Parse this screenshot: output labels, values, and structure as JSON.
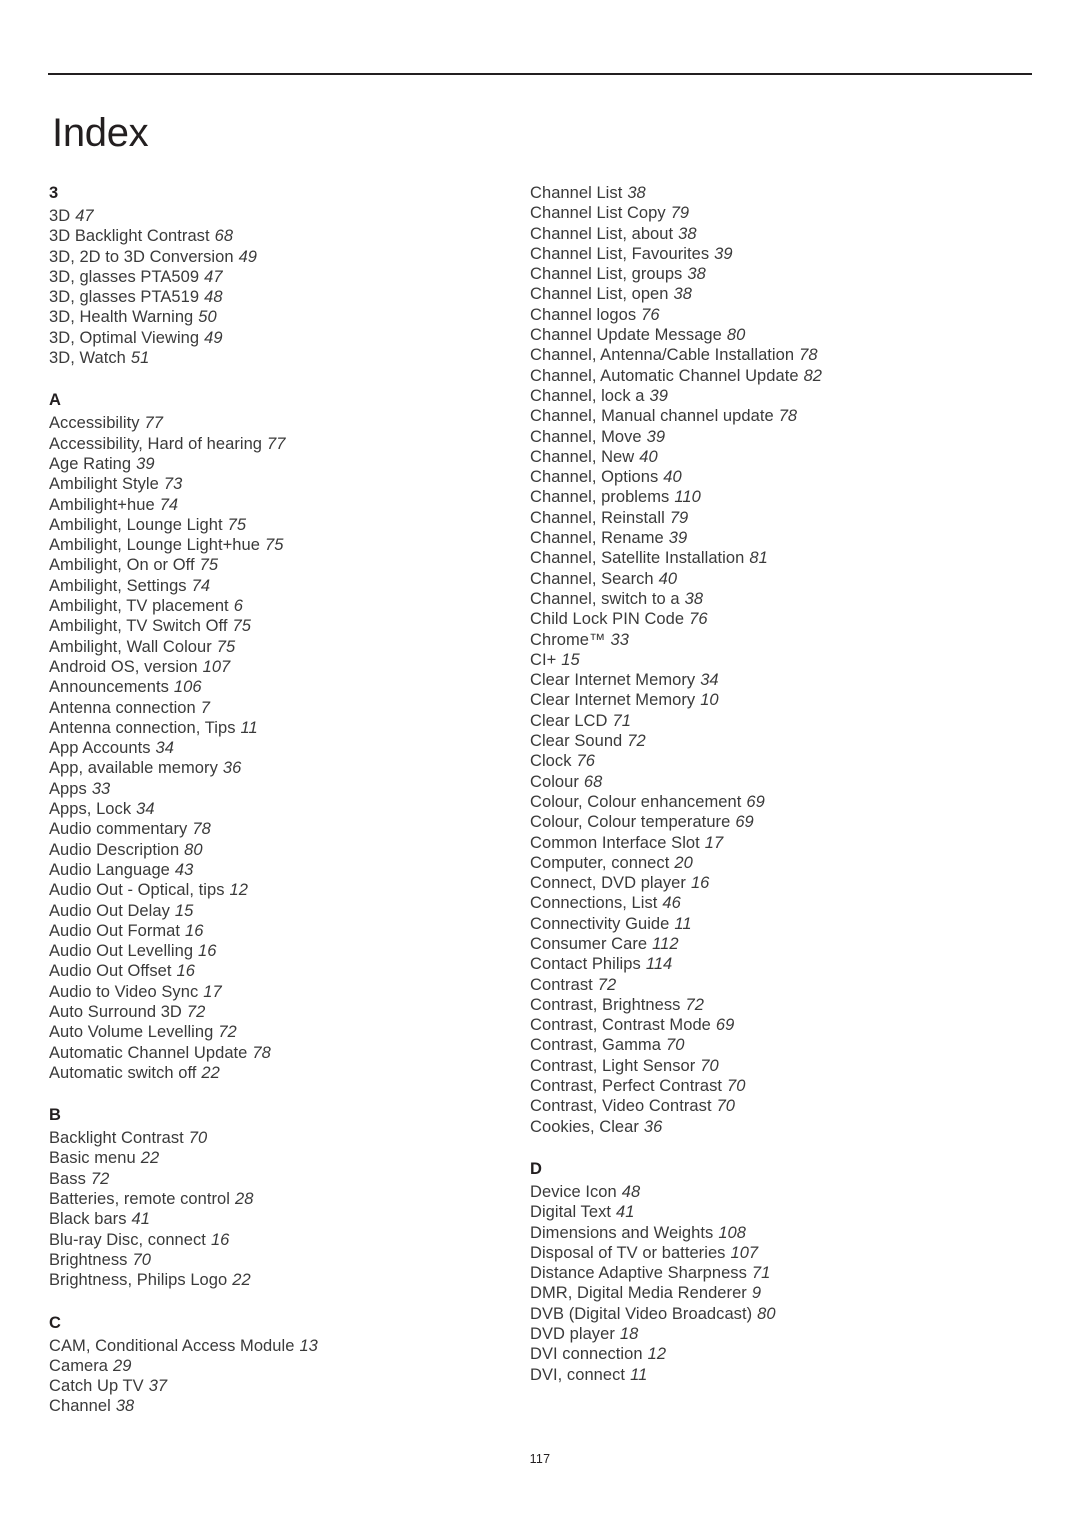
{
  "document": {
    "title": "Index",
    "folio": "117"
  },
  "columns": [
    {
      "name": "left-column",
      "sections": [
        {
          "letter": "3",
          "entries": [
            {
              "term": "3D",
              "page": "47"
            },
            {
              "term": "3D Backlight Contrast",
              "page": "68"
            },
            {
              "term": "3D, 2D to 3D Conversion",
              "page": "49"
            },
            {
              "term": "3D, glasses PTA509",
              "page": "47"
            },
            {
              "term": "3D, glasses PTA519",
              "page": "48"
            },
            {
              "term": "3D, Health Warning",
              "page": "50"
            },
            {
              "term": "3D, Optimal Viewing",
              "page": "49"
            },
            {
              "term": "3D, Watch",
              "page": "51"
            }
          ]
        },
        {
          "letter": "A",
          "entries": [
            {
              "term": "Accessibility",
              "page": "77"
            },
            {
              "term": "Accessibility, Hard of hearing",
              "page": "77"
            },
            {
              "term": "Age Rating",
              "page": "39"
            },
            {
              "term": "Ambilight Style",
              "page": "73"
            },
            {
              "term": "Ambilight+hue",
              "page": "74"
            },
            {
              "term": "Ambilight, Lounge Light",
              "page": "75"
            },
            {
              "term": "Ambilight, Lounge Light+hue",
              "page": "75"
            },
            {
              "term": "Ambilight, On or Off",
              "page": "75"
            },
            {
              "term": "Ambilight, Settings",
              "page": "74"
            },
            {
              "term": "Ambilight, TV placement",
              "page": "6"
            },
            {
              "term": "Ambilight, TV Switch Off",
              "page": "75"
            },
            {
              "term": "Ambilight, Wall Colour",
              "page": "75"
            },
            {
              "term": "Android OS, version",
              "page": "107"
            },
            {
              "term": "Announcements",
              "page": "106"
            },
            {
              "term": "Antenna connection",
              "page": "7"
            },
            {
              "term": "Antenna connection, Tips",
              "page": "11"
            },
            {
              "term": "App Accounts",
              "page": "34"
            },
            {
              "term": "App, available memory",
              "page": "36"
            },
            {
              "term": "Apps",
              "page": "33"
            },
            {
              "term": "Apps, Lock",
              "page": "34"
            },
            {
              "term": "Audio commentary",
              "page": "78"
            },
            {
              "term": "Audio Description",
              "page": "80"
            },
            {
              "term": "Audio Language",
              "page": "43"
            },
            {
              "term": "Audio Out - Optical, tips",
              "page": "12"
            },
            {
              "term": "Audio Out Delay",
              "page": "15"
            },
            {
              "term": "Audio Out Format",
              "page": "16"
            },
            {
              "term": "Audio Out Levelling",
              "page": "16"
            },
            {
              "term": "Audio Out Offset",
              "page": "16"
            },
            {
              "term": "Audio to Video Sync",
              "page": "17"
            },
            {
              "term": "Auto Surround 3D",
              "page": "72"
            },
            {
              "term": "Auto Volume Levelling",
              "page": "72"
            },
            {
              "term": "Automatic Channel Update",
              "page": "78"
            },
            {
              "term": "Automatic switch off",
              "page": "22"
            }
          ]
        },
        {
          "letter": "B",
          "entries": [
            {
              "term": "Backlight Contrast",
              "page": "70"
            },
            {
              "term": "Basic menu",
              "page": "22"
            },
            {
              "term": "Bass",
              "page": "72"
            },
            {
              "term": "Batteries, remote control",
              "page": "28"
            },
            {
              "term": "Black bars",
              "page": "41"
            },
            {
              "term": "Blu-ray Disc, connect",
              "page": "16"
            },
            {
              "term": "Brightness",
              "page": "70"
            },
            {
              "term": "Brightness, Philips Logo",
              "page": "22"
            }
          ]
        },
        {
          "letter": "C",
          "entries": [
            {
              "term": "CAM, Conditional Access Module",
              "page": "13"
            },
            {
              "term": "Camera",
              "page": "29"
            },
            {
              "term": "Catch Up TV",
              "page": "37"
            },
            {
              "term": "Channel",
              "page": "38"
            }
          ]
        }
      ]
    },
    {
      "name": "right-column",
      "sections": [
        {
          "letter": "",
          "entries": [
            {
              "term": "Channel List",
              "page": "38"
            },
            {
              "term": "Channel List Copy",
              "page": "79"
            },
            {
              "term": "Channel List, about",
              "page": "38"
            },
            {
              "term": "Channel List, Favourites",
              "page": "39"
            },
            {
              "term": "Channel List, groups",
              "page": "38"
            },
            {
              "term": "Channel List, open",
              "page": "38"
            },
            {
              "term": "Channel logos",
              "page": "76"
            },
            {
              "term": "Channel Update Message",
              "page": "80"
            },
            {
              "term": "Channel, Antenna/Cable Installation",
              "page": "78"
            },
            {
              "term": "Channel, Automatic Channel Update",
              "page": "82"
            },
            {
              "term": "Channel, lock a",
              "page": "39"
            },
            {
              "term": "Channel, Manual channel update",
              "page": "78"
            },
            {
              "term": "Channel, Move",
              "page": "39"
            },
            {
              "term": "Channel, New",
              "page": "40"
            },
            {
              "term": "Channel, Options",
              "page": "40"
            },
            {
              "term": "Channel, problems",
              "page": "110"
            },
            {
              "term": "Channel, Reinstall",
              "page": "79"
            },
            {
              "term": "Channel, Rename",
              "page": "39"
            },
            {
              "term": "Channel, Satellite Installation",
              "page": "81"
            },
            {
              "term": "Channel, Search",
              "page": "40"
            },
            {
              "term": "Channel, switch to a",
              "page": "38"
            },
            {
              "term": "Child Lock PIN Code",
              "page": "76"
            },
            {
              "term": "Chrome™",
              "page": "33"
            },
            {
              "term": "CI+",
              "page": "15"
            },
            {
              "term": "Clear Internet Memory",
              "page": "34"
            },
            {
              "term": "Clear Internet Memory",
              "page": "10"
            },
            {
              "term": "Clear LCD",
              "page": "71"
            },
            {
              "term": "Clear Sound",
              "page": "72"
            },
            {
              "term": "Clock",
              "page": "76"
            },
            {
              "term": "Colour",
              "page": "68"
            },
            {
              "term": "Colour, Colour enhancement",
              "page": "69"
            },
            {
              "term": "Colour, Colour temperature",
              "page": "69"
            },
            {
              "term": "Common Interface Slot",
              "page": "17"
            },
            {
              "term": "Computer, connect",
              "page": "20"
            },
            {
              "term": "Connect, DVD player",
              "page": "16"
            },
            {
              "term": "Connections, List",
              "page": "46"
            },
            {
              "term": "Connectivity Guide",
              "page": "11"
            },
            {
              "term": "Consumer Care",
              "page": "112"
            },
            {
              "term": "Contact Philips",
              "page": "114"
            },
            {
              "term": "Contrast",
              "page": "72"
            },
            {
              "term": "Contrast, Brightness",
              "page": "72"
            },
            {
              "term": "Contrast, Contrast Mode",
              "page": "69"
            },
            {
              "term": "Contrast, Gamma",
              "page": "70"
            },
            {
              "term": "Contrast, Light Sensor",
              "page": "70"
            },
            {
              "term": "Contrast, Perfect Contrast",
              "page": "70"
            },
            {
              "term": "Contrast, Video Contrast",
              "page": "70"
            },
            {
              "term": "Cookies, Clear",
              "page": "36"
            }
          ]
        },
        {
          "letter": "D",
          "entries": [
            {
              "term": "Device Icon",
              "page": "48"
            },
            {
              "term": "Digital Text",
              "page": "41"
            },
            {
              "term": "Dimensions and Weights",
              "page": "108"
            },
            {
              "term": "Disposal of TV or batteries",
              "page": "107"
            },
            {
              "term": "Distance Adaptive Sharpness",
              "page": "71"
            },
            {
              "term": "DMR, Digital Media Renderer",
              "page": "9"
            },
            {
              "term": "DVB (Digital Video Broadcast)",
              "page": "80"
            },
            {
              "term": "DVD player",
              "page": "18"
            },
            {
              "term": "DVI connection",
              "page": "12"
            },
            {
              "term": "DVI, connect",
              "page": "11"
            }
          ]
        }
      ]
    }
  ]
}
